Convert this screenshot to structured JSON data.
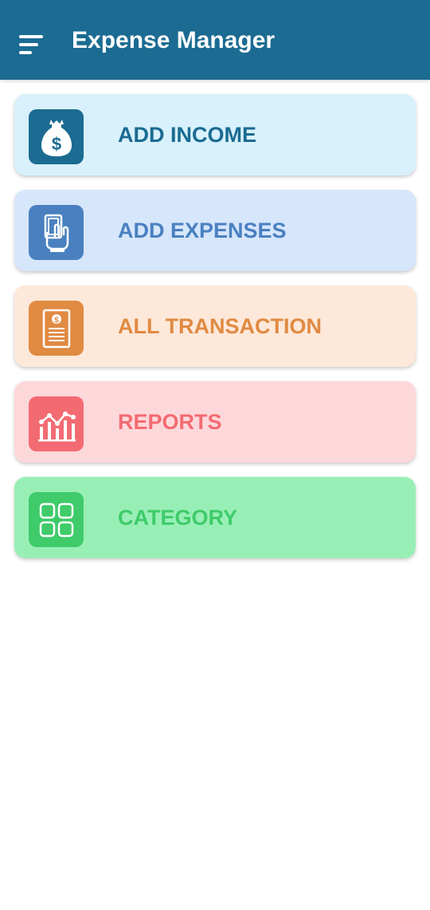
{
  "app_bar": {
    "title": "Expense Manager",
    "menu_icon": "menu-icon",
    "background": "#1b6b92"
  },
  "menu": {
    "items": [
      {
        "label": "ADD INCOME",
        "icon": "money-bag-icon",
        "bg": "#d8f1fc",
        "accent": "#1b6b92"
      },
      {
        "label": "ADD EXPENSES",
        "icon": "hand-cash-icon",
        "bg": "#d6e6fb",
        "accent": "#4a80c0"
      },
      {
        "label": "ALL TRANSACTION",
        "icon": "receipt-icon",
        "bg": "#fde8da",
        "accent": "#e08a42"
      },
      {
        "label": "REPORTS",
        "icon": "chart-icon",
        "bg": "#fdd8da",
        "accent": "#f36b72"
      },
      {
        "label": "CATEGORY",
        "icon": "grid-icon",
        "bg": "#98efb6",
        "accent": "#3fcb6a"
      }
    ]
  }
}
